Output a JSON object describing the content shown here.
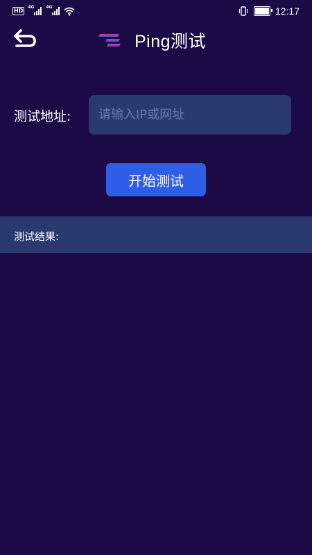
{
  "status_bar": {
    "hd_badge": "HD",
    "signal1_tag": "4G",
    "signal2_tag": "4G",
    "time": "12:17",
    "icons": [
      "hd-icon",
      "signal-icon",
      "signal-icon",
      "wifi-icon",
      "vibrate-icon",
      "battery-icon"
    ]
  },
  "header": {
    "title": "Ping测试",
    "back_icon": "back-arrow-icon",
    "logo_icon": "logo-icon"
  },
  "form": {
    "address_label": "测试地址:",
    "address_placeholder": "请输入IP或网址",
    "address_value": "",
    "start_button_label": "开始测试"
  },
  "result": {
    "label": "测试结果:",
    "content": ""
  },
  "colors": {
    "background": "#1b0a46",
    "panel": "#2a3a6e",
    "button": "#2e5ee6",
    "placeholder": "#6a7aa8",
    "logo_pink": "#e0307a",
    "logo_blue": "#3a5fe6"
  }
}
